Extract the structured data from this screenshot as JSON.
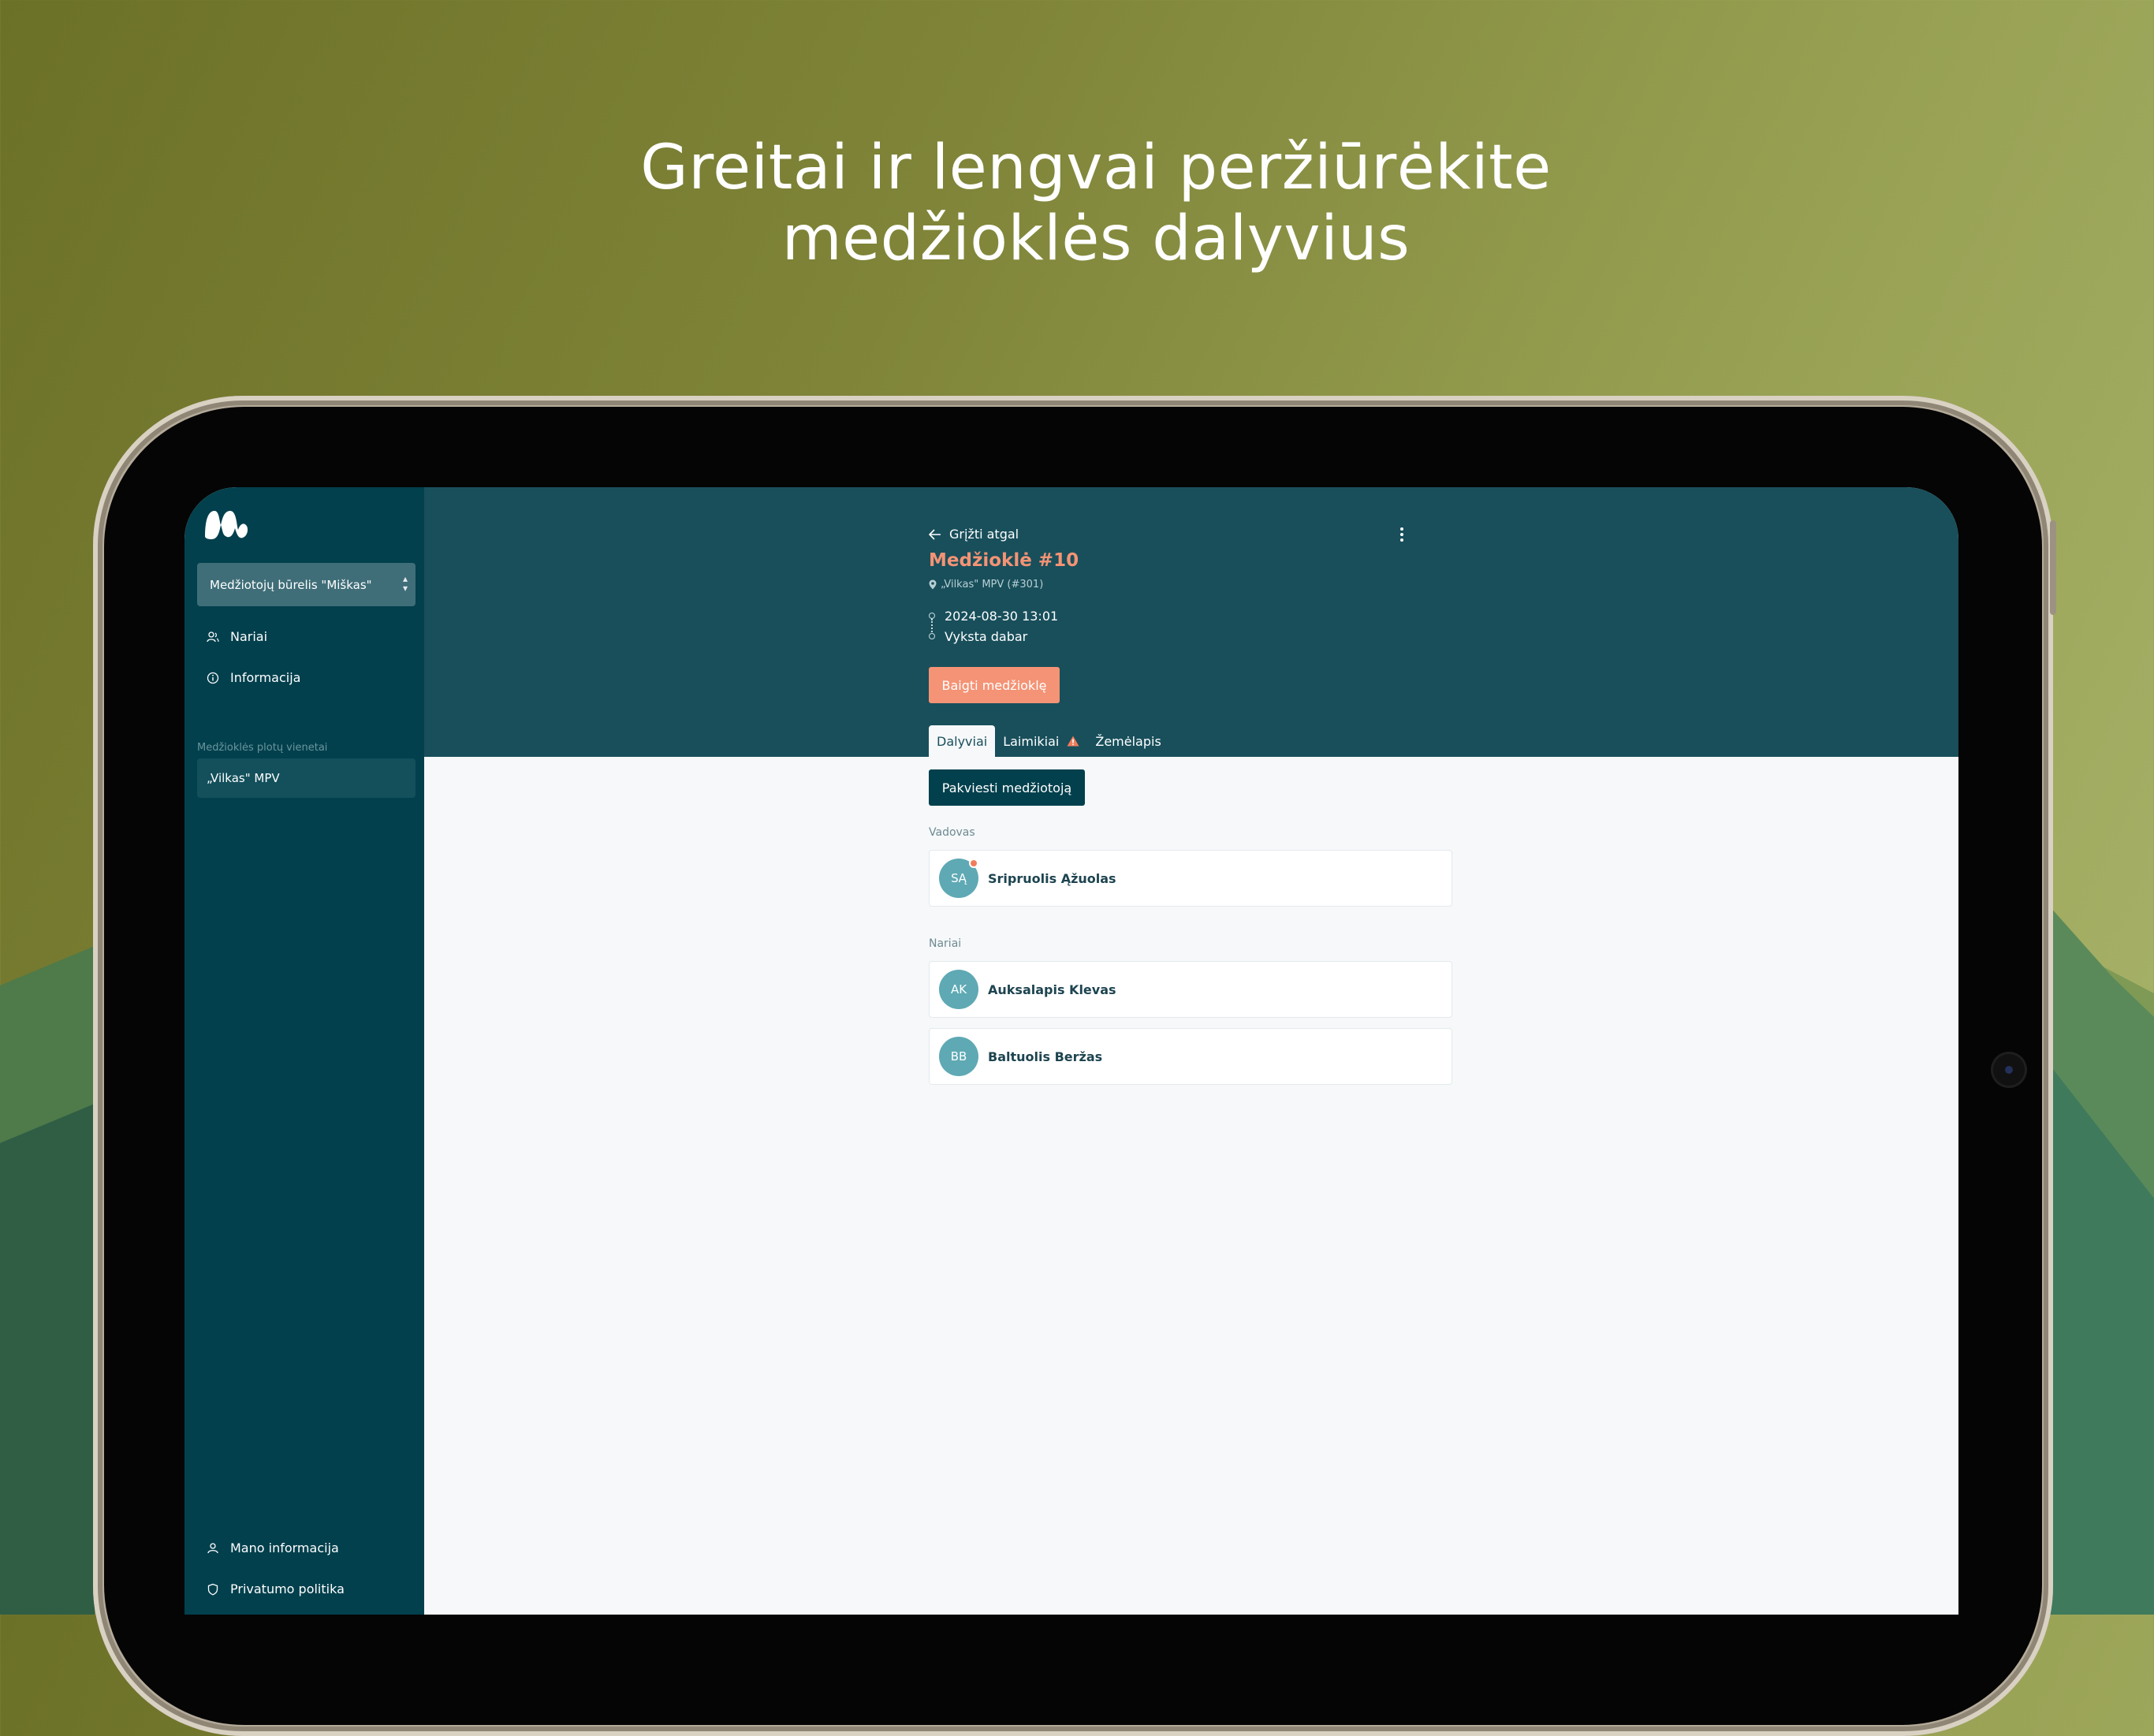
{
  "marketing": {
    "headline_line1": "Greitai ir lengvai peržiūrėkite",
    "headline_line2": "medžioklės dalyvius"
  },
  "colors": {
    "sidebar_bg": "#02404d",
    "header_bg": "#184f5b",
    "accent": "#f49375",
    "avatar_bg": "#5ea9b4"
  },
  "sidebar": {
    "logo_icon": "app-logo-icon",
    "club_select": "Medžiotojų būrelis \"Miškas\"",
    "nav_items": [
      {
        "label": "Nariai",
        "icon": "users-icon"
      },
      {
        "label": "Informacija",
        "icon": "info-icon"
      }
    ],
    "section_label": "Medžioklės plotų vienetai",
    "units": [
      "„Vilkas\" MPV"
    ],
    "bottom_items": [
      {
        "label": "Mano informacija",
        "icon": "user-icon"
      },
      {
        "label": "Privatumo politika",
        "icon": "shield-icon"
      }
    ]
  },
  "hunt": {
    "back_label": "Grįžti atgal",
    "title": "Medžioklė #10",
    "location": "„Vilkas\" MPV (#301)",
    "start": "2024-08-30 13:01",
    "status": "Vyksta dabar",
    "end_button": "Baigti medžioklę"
  },
  "tabs": [
    {
      "label": "Dalyviai",
      "active": true
    },
    {
      "label": "Laimikiai",
      "active": false,
      "warning": true
    },
    {
      "label": "Žemėlapis",
      "active": false
    }
  ],
  "participants": {
    "invite_button": "Pakviesti medžiotoją",
    "leader_label": "Vadovas",
    "leader": {
      "initials": "SĄ",
      "name": "Sripruolis Ąžuolas"
    },
    "members_label": "Nariai",
    "members": [
      {
        "initials": "AK",
        "name": "Auksalapis Klevas"
      },
      {
        "initials": "BB",
        "name": "Baltuolis Beržas"
      }
    ]
  }
}
